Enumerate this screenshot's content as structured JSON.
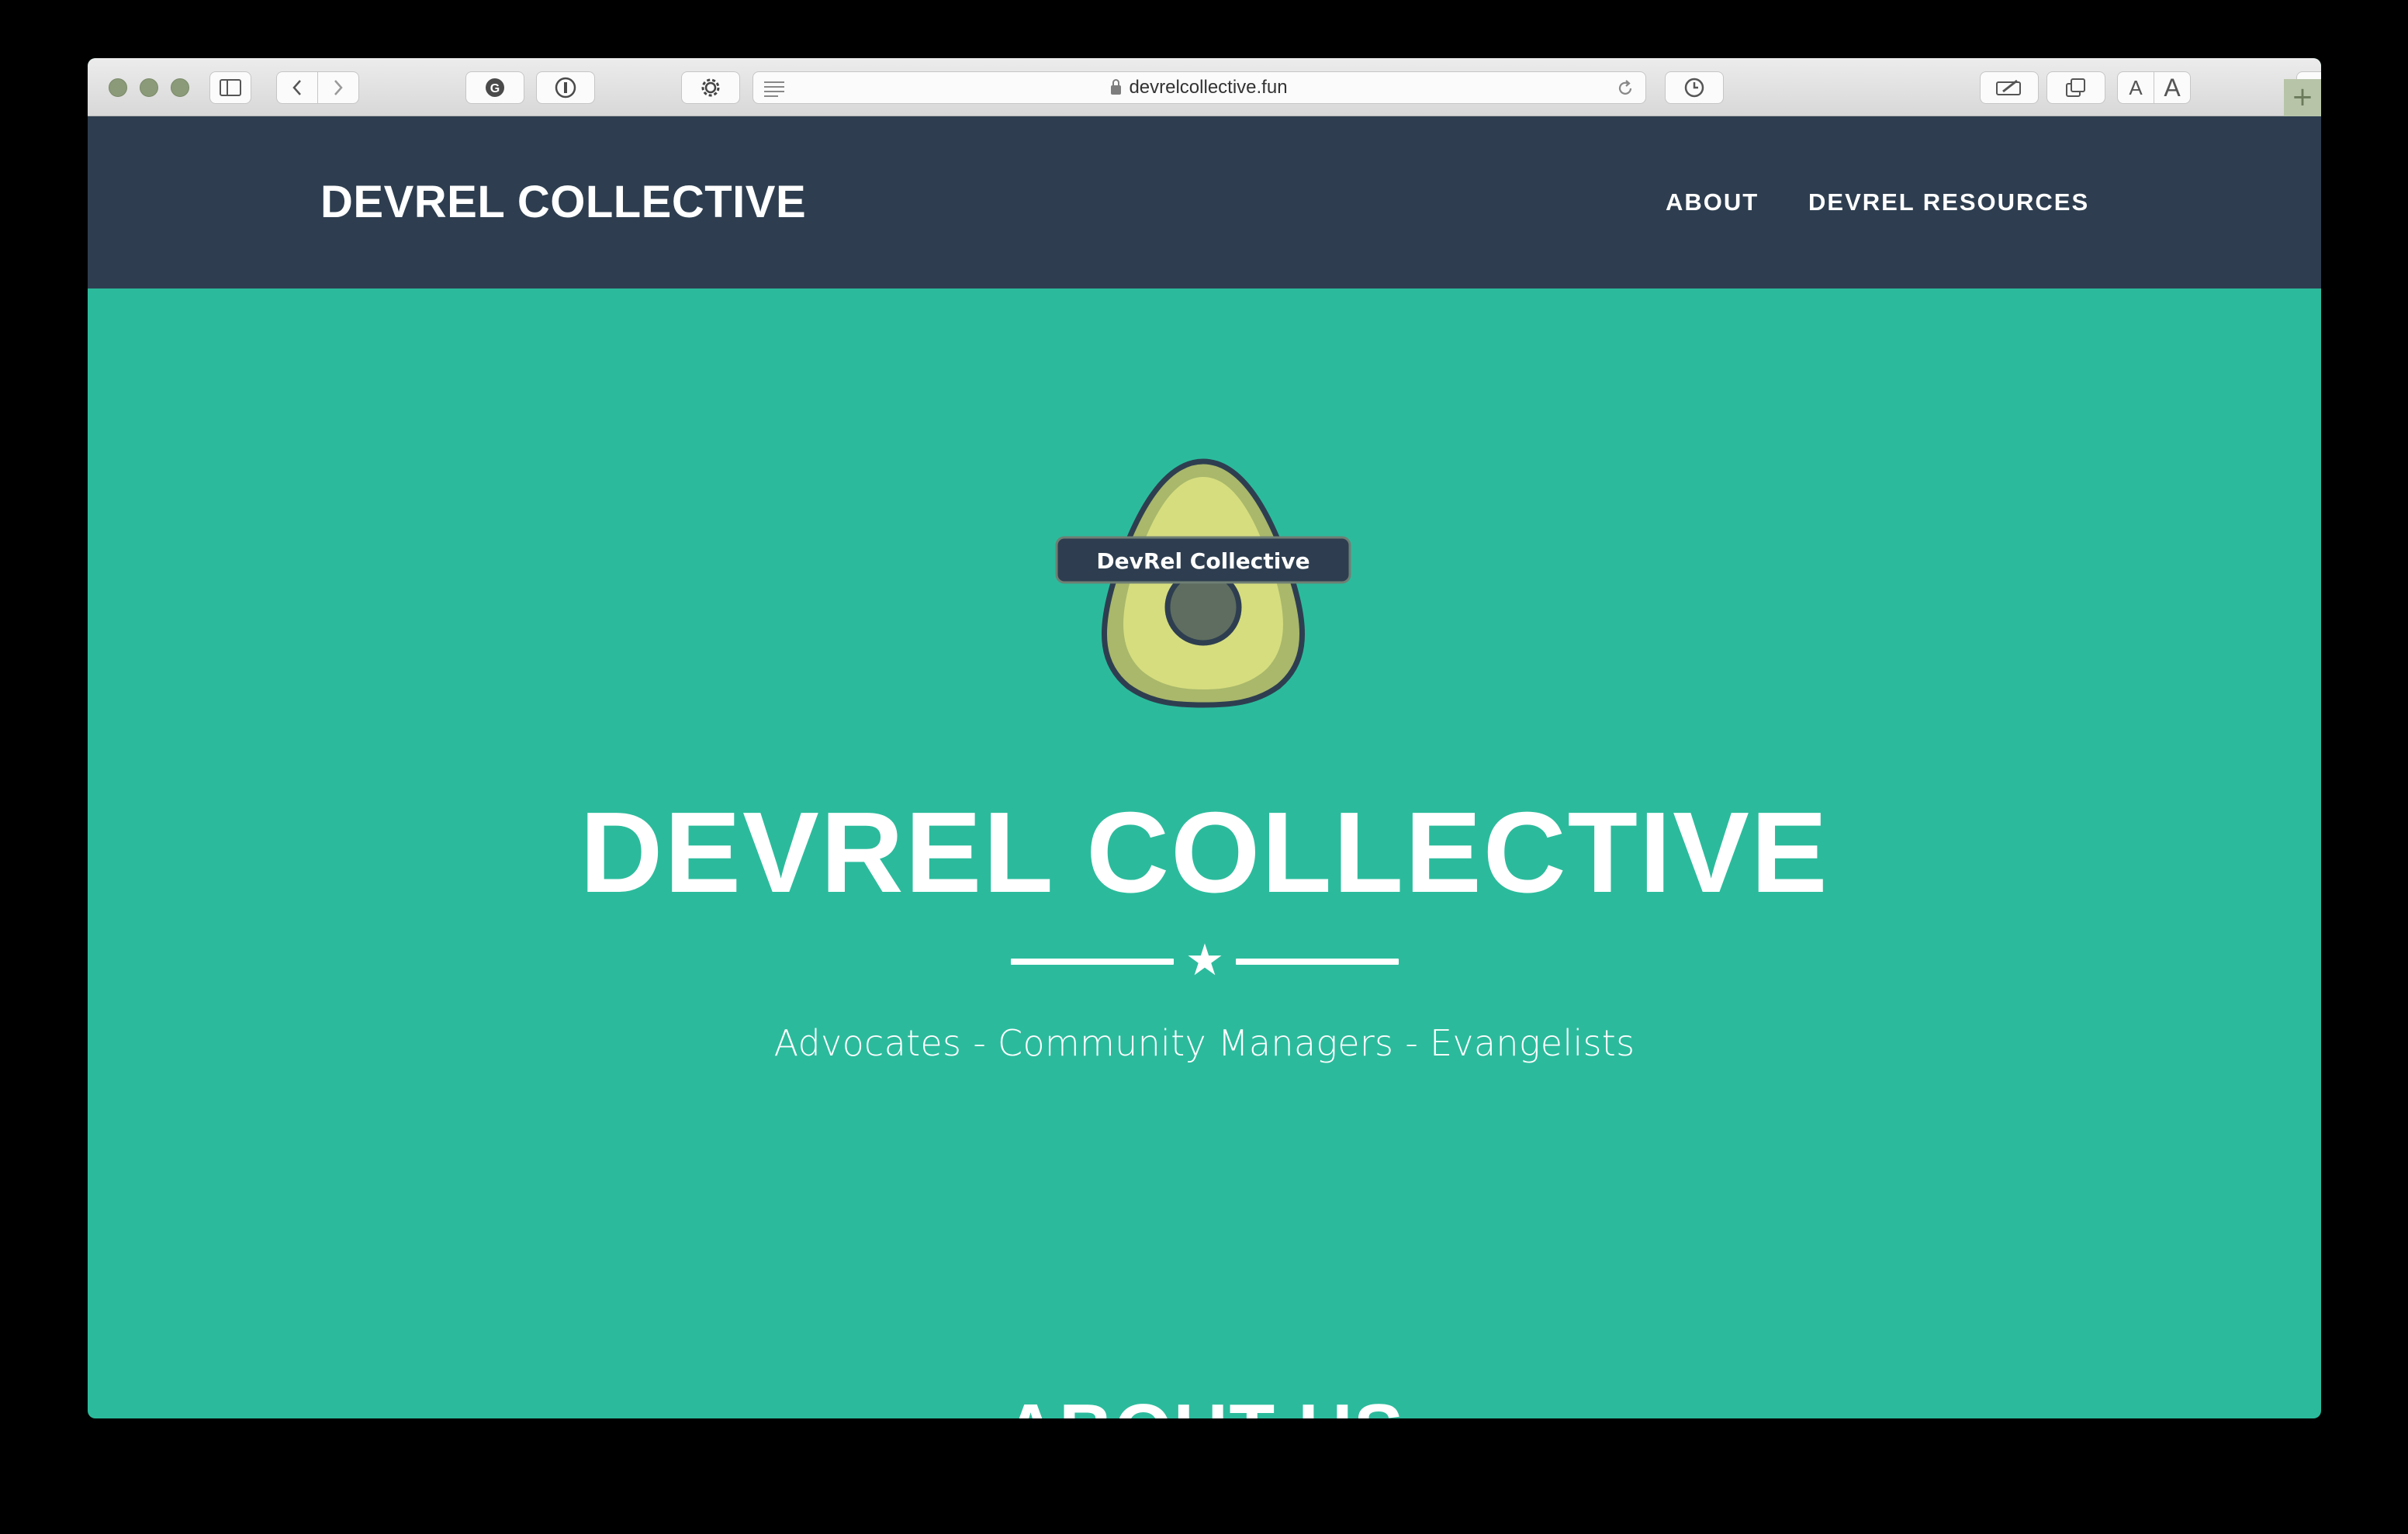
{
  "browser": {
    "url": "devrelcollective.fun",
    "font_smaller_label": "A",
    "font_larger_label": "A",
    "new_tab_label": "+"
  },
  "navbar": {
    "brand": "DEVREL COLLECTIVE",
    "links": [
      {
        "label": "ABOUT"
      },
      {
        "label": "DEVREL RESOURCES"
      }
    ]
  },
  "hero": {
    "logo_text": "DevRel Collective",
    "title": "DEVREL COLLECTIVE",
    "divider_icon": "star-icon",
    "tagline": "Advocates - Community Managers - Evangelists"
  },
  "about": {
    "heading": "ABOUT US"
  },
  "colors": {
    "navbar_bg": "#2e3e50",
    "hero_bg": "#2bbb9c",
    "text": "#ffffff",
    "avocado_skin": "#a9b86a",
    "avocado_flesh": "#d6dd7f",
    "avocado_pit": "#5e6d5f"
  }
}
